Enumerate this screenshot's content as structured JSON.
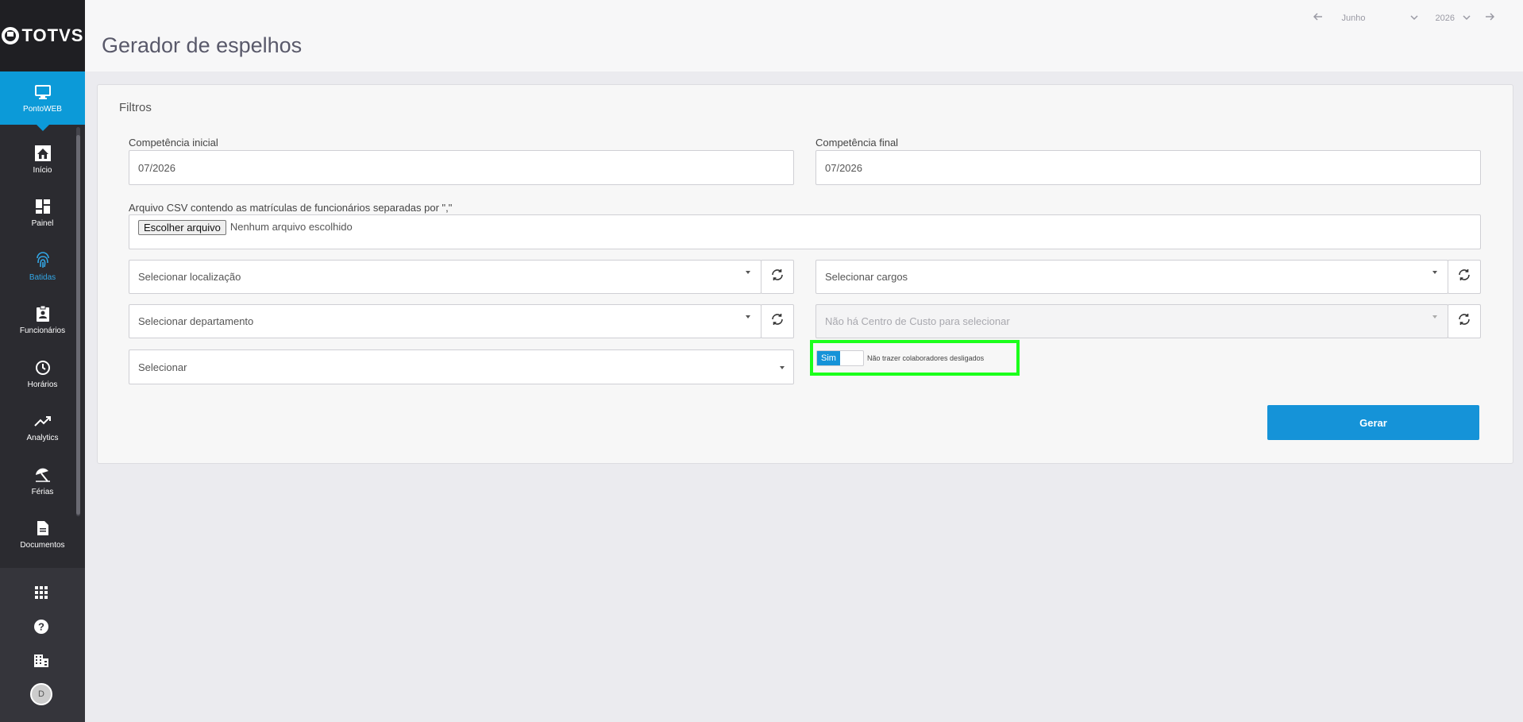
{
  "brand": {
    "logo_text": "TOTVS"
  },
  "sidebar": {
    "active": {
      "label": "PontoWEB"
    },
    "items": [
      {
        "label": "Início",
        "icon": "home-icon"
      },
      {
        "label": "Painel",
        "icon": "dashboard-icon"
      },
      {
        "label": "Batidas",
        "icon": "fingerprint-icon"
      },
      {
        "label": "Funcionários",
        "icon": "badge-icon"
      },
      {
        "label": "Horários",
        "icon": "clock-icon"
      },
      {
        "label": "Analytics",
        "icon": "trending-icon"
      },
      {
        "label": "Férias",
        "icon": "umbrella-icon"
      },
      {
        "label": "Documentos",
        "icon": "document-icon"
      }
    ],
    "avatar_initial": "D"
  },
  "header": {
    "title": "Gerador de espelhos",
    "month": "Junho",
    "year": "2026"
  },
  "filters": {
    "title": "Filtros",
    "competencia_inicial": {
      "label": "Competência inicial",
      "value": "07/2026"
    },
    "competencia_final": {
      "label": "Competência final",
      "value": "07/2026"
    },
    "csv": {
      "label": "Arquivo CSV contendo as matrículas de funcionários separadas por \",\"",
      "button": "Escolher arquivo",
      "status": "Nenhum arquivo escolhido"
    },
    "localizacao": "Selecionar localização",
    "cargos": "Selecionar cargos",
    "departamento": "Selecionar departamento",
    "centro_custo": "Não há Centro de Custo para selecionar",
    "selecionar": "Selecionar",
    "toggle": {
      "on_label": "Sim",
      "label": "Não trazer colaboradores desligados"
    },
    "gerar": "Gerar"
  },
  "colors": {
    "accent": "#1593d8",
    "sidebar": "#2b2b30",
    "highlight": "#1bff1b"
  }
}
